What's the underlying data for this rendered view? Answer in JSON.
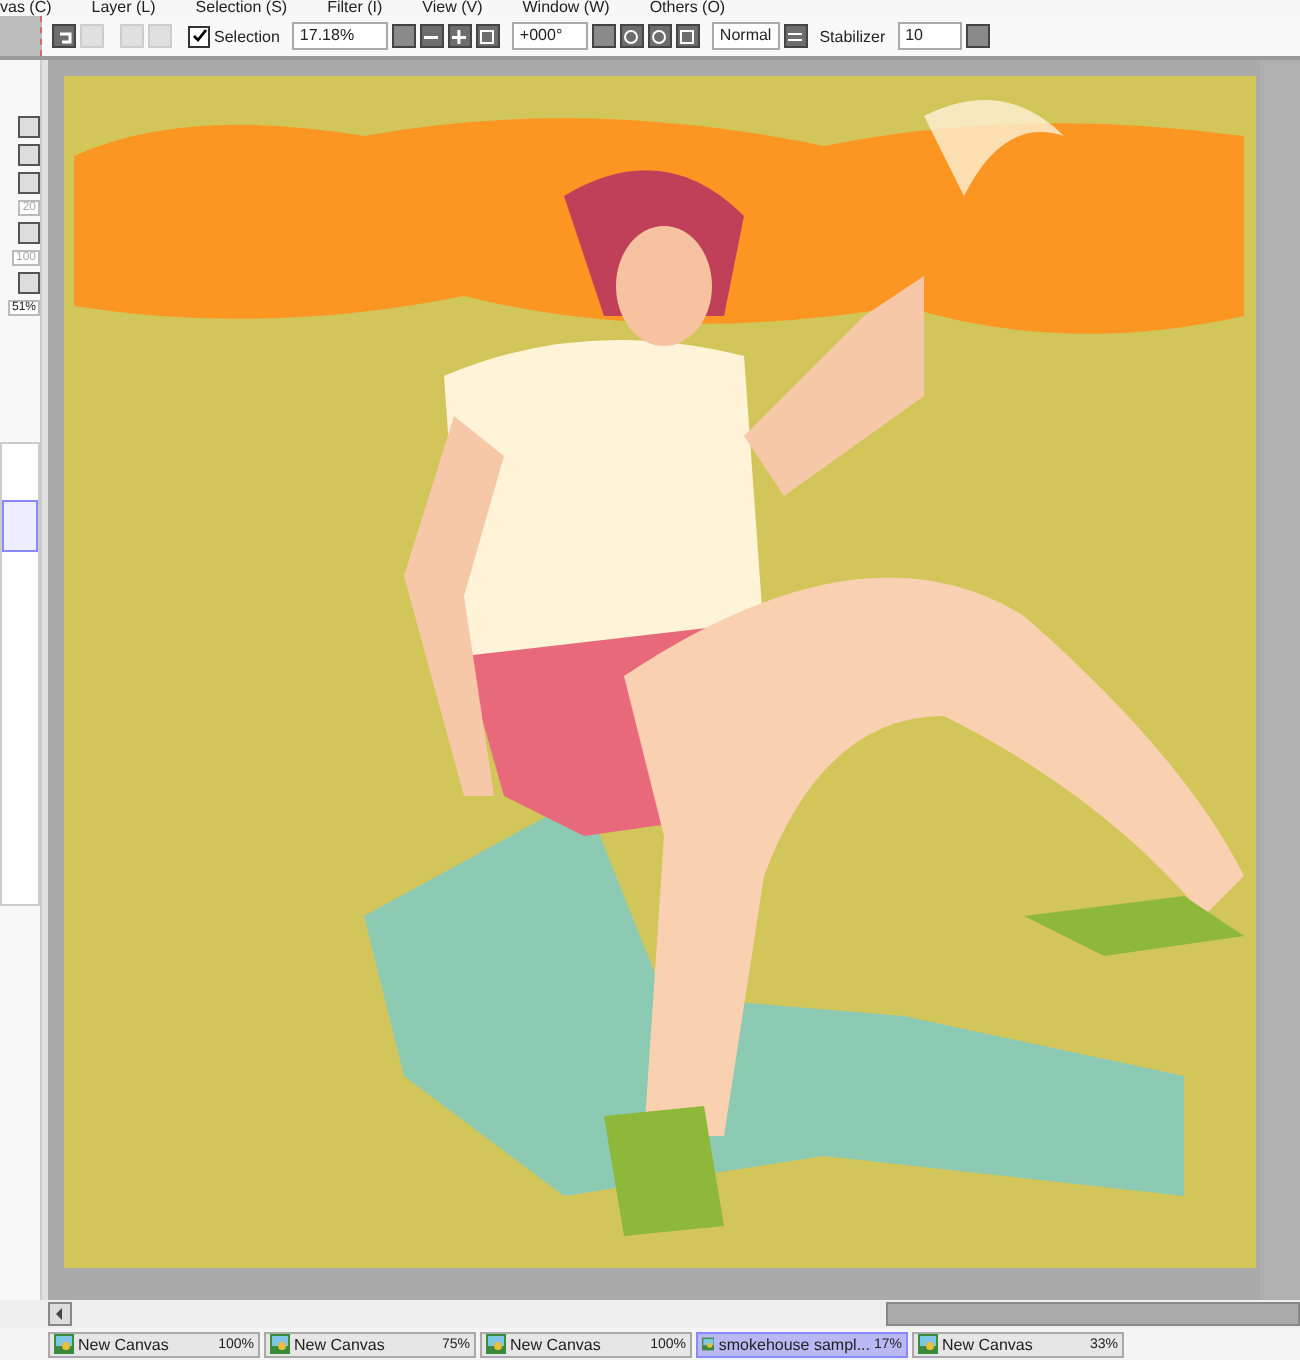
{
  "menu": [
    "vas (C)",
    "Layer (L)",
    "Selection (S)",
    "Filter (I)",
    "View (V)",
    "Window (W)",
    "Others (O)"
  ],
  "toolbar": {
    "selection": {
      "label": "Selection",
      "checked": true
    },
    "zoom": "17.18%",
    "angle": "+000°",
    "blend": "Normal",
    "stabilizer_label": "Stabilizer",
    "stabilizer": "10"
  },
  "side_panel": {
    "values": [
      "20",
      "100",
      "51%"
    ]
  },
  "tabs": [
    {
      "label": "New Canvas",
      "zoom": "100%",
      "selected": false
    },
    {
      "label": "New Canvas",
      "zoom": "75%",
      "selected": false
    },
    {
      "label": "New Canvas",
      "zoom": "100%",
      "selected": false
    },
    {
      "label": "smokehouse sampl...",
      "zoom": "17%",
      "selected": true
    },
    {
      "label": "New Canvas",
      "zoom": "33%",
      "selected": false
    }
  ]
}
